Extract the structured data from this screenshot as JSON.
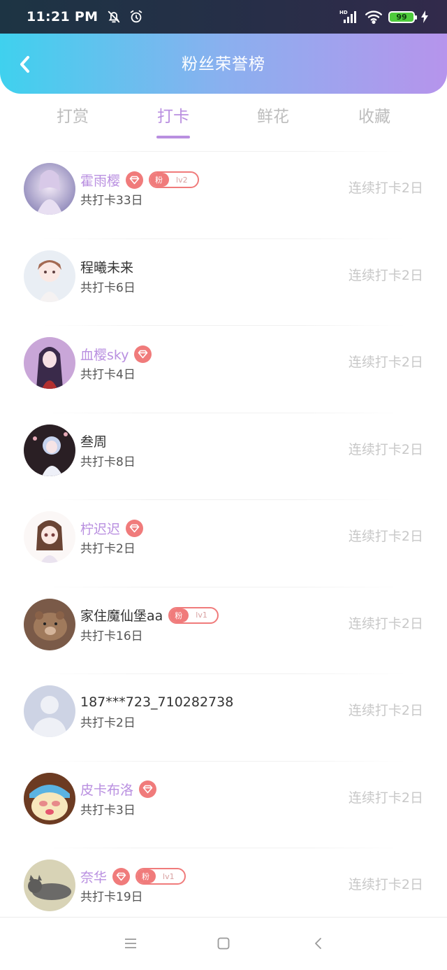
{
  "status_bar": {
    "time": "11:21 PM",
    "battery": "99",
    "icons": [
      "bell-off-icon",
      "alarm-icon",
      "hd-signal-icon",
      "wifi-icon",
      "charging-icon"
    ]
  },
  "header": {
    "title": "粉丝荣誉榜",
    "back_icon": "chevron-left-icon",
    "gradient": [
      "#3fd1ee",
      "#b694ec"
    ]
  },
  "tabs": [
    {
      "label": "打赏",
      "active": false
    },
    {
      "label": "打卡",
      "active": true
    },
    {
      "label": "鲜花",
      "active": false
    },
    {
      "label": "收藏",
      "active": false
    }
  ],
  "accent_color": "#b98fe0",
  "badge_color": "#f07b7b",
  "fans": [
    {
      "name": "霍雨樱",
      "vip": true,
      "fan_badge": {
        "tag": "粉",
        "level": "lv2"
      },
      "total": "共打卡33日",
      "streak": "连续打卡2日"
    },
    {
      "name": "程曦未来",
      "vip": false,
      "fan_badge": null,
      "total": "共打卡6日",
      "streak": "连续打卡2日"
    },
    {
      "name": "血樱sky",
      "vip": true,
      "fan_badge": null,
      "total": "共打卡4日",
      "streak": "连续打卡2日"
    },
    {
      "name": "叁周",
      "vip": false,
      "fan_badge": null,
      "total": "共打卡8日",
      "streak": "连续打卡2日"
    },
    {
      "name": "柠迟迟",
      "vip": true,
      "fan_badge": null,
      "total": "共打卡2日",
      "streak": "连续打卡2日"
    },
    {
      "name": "家住魔仙堡aa",
      "vip": false,
      "fan_badge": {
        "tag": "粉",
        "level": "lv1"
      },
      "total": "共打卡16日",
      "streak": "连续打卡2日"
    },
    {
      "name": "187***723_710282738",
      "vip": false,
      "fan_badge": null,
      "total": "共打卡2日",
      "streak": "连续打卡2日"
    },
    {
      "name": "皮卡布洛",
      "vip": true,
      "fan_badge": null,
      "total": "共打卡3日",
      "streak": "连续打卡2日"
    },
    {
      "name": "奈华",
      "vip": true,
      "fan_badge": {
        "tag": "粉",
        "level": "lv1"
      },
      "total": "共打卡19日",
      "streak": "连续打卡2日"
    }
  ],
  "nav_bar": {
    "icons": [
      "menu-icon",
      "home-square-icon",
      "back-triangle-icon"
    ]
  }
}
